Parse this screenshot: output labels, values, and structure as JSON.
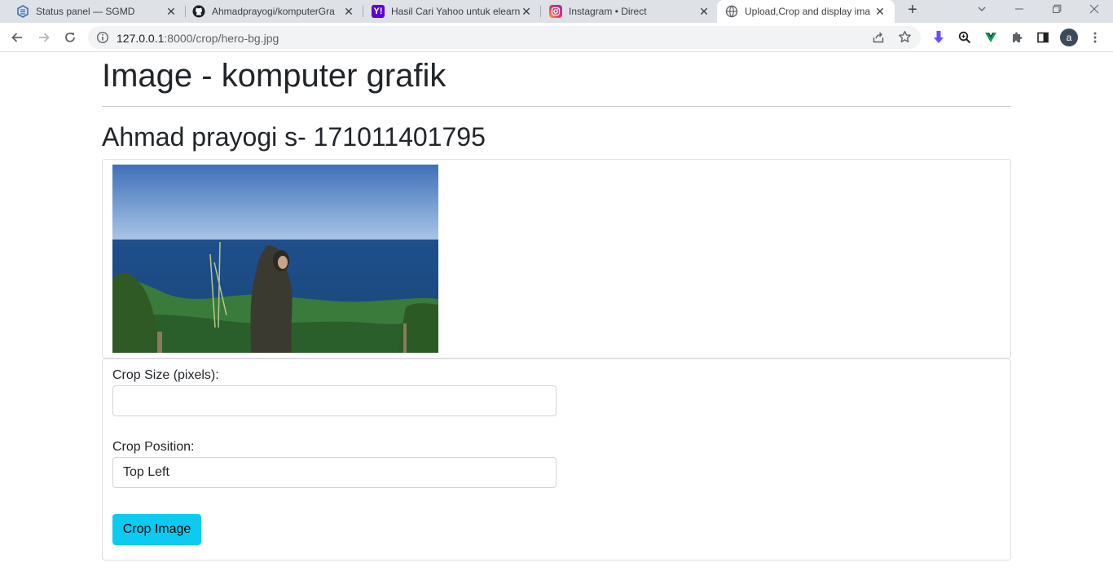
{
  "browser": {
    "tabs": [
      {
        "title": "Status panel — SGMD",
        "icon": "sgmd-icon",
        "active": false
      },
      {
        "title": "Ahmadprayogi/komputerGra",
        "icon": "github-icon",
        "active": false
      },
      {
        "title": "Hasil Cari Yahoo untuk elearn",
        "icon": "yahoo-icon",
        "active": false
      },
      {
        "title": "Instagram • Direct",
        "icon": "instagram-icon",
        "active": false
      },
      {
        "title": "Upload,Crop and display ima",
        "icon": "globe-icon",
        "active": true
      }
    ],
    "url_host": "127.0.0.1",
    "url_path": ":8000/crop/hero-bg.jpg",
    "profile_initial": "a"
  },
  "page": {
    "title": "Image - komputer grafik",
    "subtitle": "Ahmad prayogi s- 171011401795",
    "form": {
      "crop_size_label": "Crop Size (pixels):",
      "crop_size_value": "",
      "crop_position_label": "Crop Position:",
      "crop_position_value": "Top Left",
      "submit_label": "Crop Image"
    }
  },
  "colors": {
    "button_bg": "#0dcaf0",
    "tab_strip": "#dee1e6"
  }
}
